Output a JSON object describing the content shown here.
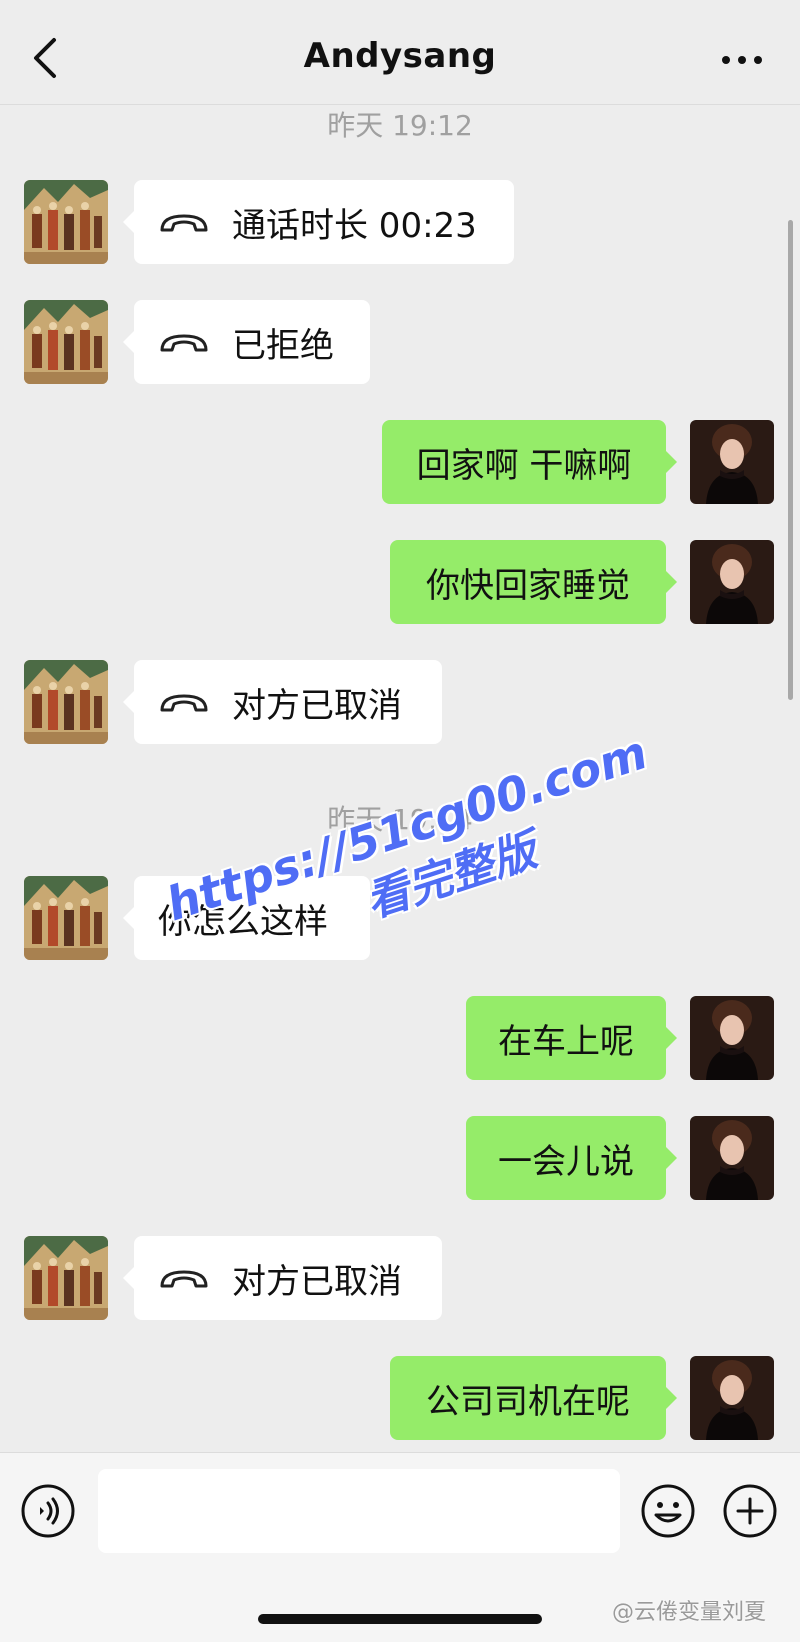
{
  "header": {
    "title": "Andysang"
  },
  "messages": [
    {
      "type": "timestamp",
      "text": "昨天 19:12"
    },
    {
      "type": "call",
      "side": "in",
      "text": "通话时长 00:23"
    },
    {
      "type": "call",
      "side": "in",
      "text": "已拒绝"
    },
    {
      "type": "text",
      "side": "out",
      "text": "回家啊 干嘛啊"
    },
    {
      "type": "text",
      "side": "out",
      "text": "你快回家睡觉"
    },
    {
      "type": "call",
      "side": "in",
      "text": "对方已取消"
    },
    {
      "type": "timestamp",
      "text": "昨天 19:14"
    },
    {
      "type": "text",
      "side": "in",
      "text": "你怎么这样"
    },
    {
      "type": "text",
      "side": "out",
      "text": "在车上呢"
    },
    {
      "type": "text",
      "side": "out",
      "text": "一会儿说"
    },
    {
      "type": "call",
      "side": "in",
      "text": "对方已取消"
    },
    {
      "type": "text",
      "side": "out",
      "text": "公司司机在呢"
    }
  ],
  "watermark": {
    "line1": "https://51cg00.com",
    "line2": "看完整版"
  },
  "composer": {
    "value": ""
  },
  "credit": "@云倦变量刘夏",
  "colors": {
    "outgoing_bubble": "#95ec69",
    "incoming_bubble": "#ffffff",
    "background": "#ededed",
    "watermark": "#4f6df5"
  },
  "icons": {
    "back": "chevron-left-icon",
    "more": "more-dots-icon",
    "call": "phone-handset-icon",
    "voice": "voice-input-icon",
    "emoji": "emoji-icon",
    "plus": "plus-icon"
  }
}
